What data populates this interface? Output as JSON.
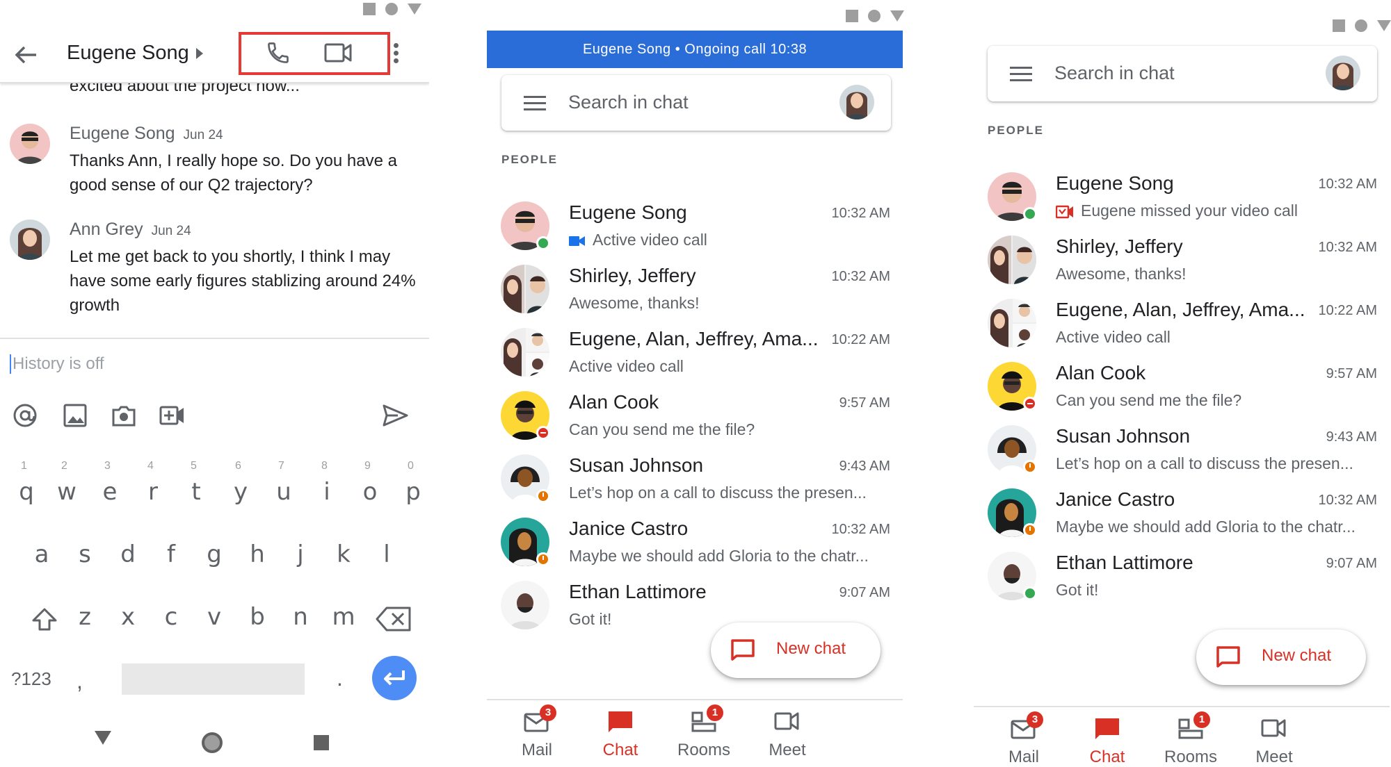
{
  "panel1": {
    "contact_name": "Eugene Song",
    "cut_message": "excited about the project now...",
    "messages": [
      {
        "name": "Eugene Song",
        "date": "Jun 24",
        "body": "Thanks Ann, I really hope so. Do you have a good sense of our Q2 trajectory?"
      },
      {
        "name": "Ann Grey",
        "date": "Jun 24",
        "body": "Let me get back to you shortly, I think I may have some early figures stablizing around 24% growth"
      }
    ],
    "input_placeholder": "History is off",
    "keyboard": {
      "numbers": [
        "1",
        "2",
        "3",
        "4",
        "5",
        "6",
        "7",
        "8",
        "9",
        "0"
      ],
      "row1": [
        "q",
        "w",
        "e",
        "r",
        "t",
        "y",
        "u",
        "i",
        "o",
        "p"
      ],
      "row2": [
        "a",
        "s",
        "d",
        "f",
        "g",
        "h",
        "j",
        "k",
        "l"
      ],
      "row3": [
        "z",
        "x",
        "c",
        "v",
        "b",
        "n",
        "m"
      ],
      "symbols_key": "?123",
      "comma": ",",
      "period": "."
    }
  },
  "panel2": {
    "banner": "Eugene Song • Ongoing call 10:38",
    "search_placeholder": "Search in chat",
    "section": "PEOPLE",
    "rows": [
      {
        "name": "Eugene Song",
        "time": "10:32 AM",
        "sub": "Active video call",
        "status": "online",
        "sub_icon": "video-call-icon"
      },
      {
        "name": "Shirley, Jeffery",
        "time": "10:32 AM",
        "sub": "Awesome, thanks!"
      },
      {
        "name": "Eugene, Alan, Jeffrey, Ama...",
        "time": "10:22 AM",
        "sub": "Active video call"
      },
      {
        "name": "Alan Cook",
        "time": "9:57 AM",
        "sub": "Can you send me the file?",
        "status": "dnd"
      },
      {
        "name": "Susan Johnson",
        "time": "9:43 AM",
        "sub": "Let’s hop on a call to discuss the presen...",
        "status": "away"
      },
      {
        "name": "Janice Castro",
        "time": "10:32 AM",
        "sub": "Maybe we should add Gloria to the chatr...",
        "status": "away"
      },
      {
        "name": "Ethan Lattimore",
        "time": "9:07 AM",
        "sub": "Got it!"
      }
    ],
    "fab_label": "New chat",
    "nav": [
      {
        "label": "Mail",
        "badge": "3"
      },
      {
        "label": "Chat",
        "badge": ""
      },
      {
        "label": "Rooms",
        "badge": "1"
      },
      {
        "label": "Meet",
        "badge": ""
      }
    ]
  },
  "panel3": {
    "search_placeholder": "Search in chat",
    "section": "PEOPLE",
    "rows": [
      {
        "name": "Eugene Song",
        "time": "10:32 AM",
        "sub": "Eugene missed your video call",
        "status": "online",
        "sub_icon": "missed-video-call-icon"
      },
      {
        "name": "Shirley, Jeffery",
        "time": "10:32 AM",
        "sub": "Awesome, thanks!"
      },
      {
        "name": "Eugene, Alan, Jeffrey, Ama...",
        "time": "10:22 AM",
        "sub": "Active video call"
      },
      {
        "name": "Alan Cook",
        "time": "9:57 AM",
        "sub": "Can you send me the file?",
        "status": "dnd"
      },
      {
        "name": "Susan Johnson",
        "time": "9:43 AM",
        "sub": "Let’s hop on a call to discuss the presen...",
        "status": "away"
      },
      {
        "name": "Janice Castro",
        "time": "10:32 AM",
        "sub": "Maybe we should add Gloria to the chatr...",
        "status": "away"
      },
      {
        "name": "Ethan Lattimore",
        "time": "9:07 AM",
        "sub": "Got it!",
        "status": "online"
      }
    ],
    "fab_label": "New chat",
    "nav": [
      {
        "label": "Mail",
        "badge": "3"
      },
      {
        "label": "Chat",
        "badge": ""
      },
      {
        "label": "Rooms",
        "badge": "1"
      },
      {
        "label": "Meet",
        "badge": ""
      }
    ]
  },
  "colors": {
    "accent_red": "#d93025",
    "banner_blue": "#2a6cd8",
    "online": "#34a853",
    "away": "#e37400",
    "highlight_box": "#e53935"
  }
}
